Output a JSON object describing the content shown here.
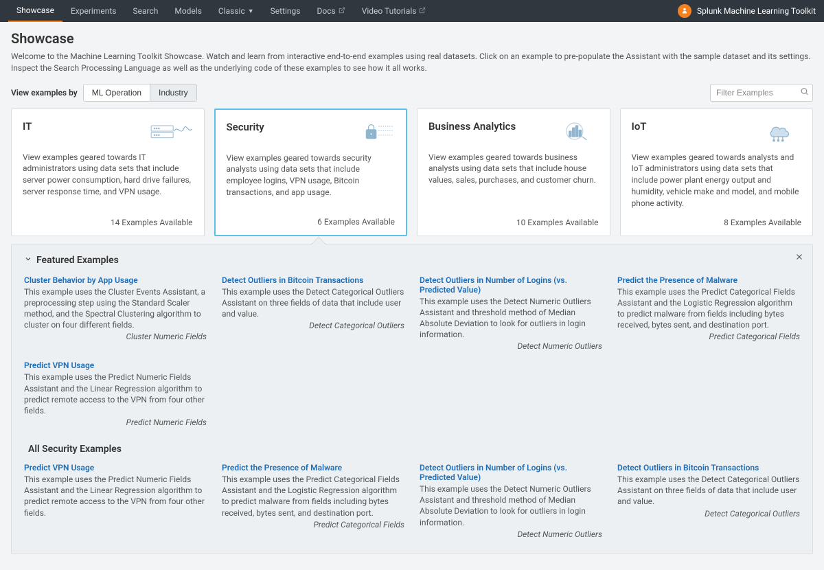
{
  "brand": "Splunk Machine Learning Toolkit",
  "nav": {
    "showcase": "Showcase",
    "experiments": "Experiments",
    "search": "Search",
    "models": "Models",
    "classic": "Classic",
    "settings": "Settings",
    "docs": "Docs",
    "video": "Video Tutorials"
  },
  "page": {
    "title": "Showcase",
    "subtitle": "Welcome to the Machine Learning Toolkit Showcase. Watch and learn from interactive end-to-end examples using real datasets. Click on an example to pre-populate the Assistant with the sample dataset and its settings. Inspect the Search Processing Language as well as the underlying code of these examples to see how it all works."
  },
  "filter": {
    "label": "View examples by",
    "opt1": "ML Operation",
    "opt2": "Industry"
  },
  "search": {
    "placeholder": "Filter Examples"
  },
  "cards": [
    {
      "title": "IT",
      "desc": "View examples geared towards IT administrators using data sets that include server power consumption, hard drive failures, server response time, and VPN usage.",
      "foot": "14 Examples Available"
    },
    {
      "title": "Security",
      "desc": "View examples geared towards security analysts using data sets that include employee logins, VPN usage, Bitcoin transactions, and app usage.",
      "foot": "6 Examples Available"
    },
    {
      "title": "Business Analytics",
      "desc": "View examples geared towards business analysts using data sets that include house values, sales, purchases, and customer churn.",
      "foot": "10 Examples Available"
    },
    {
      "title": "IoT",
      "desc": "View examples geared towards analysts and IoT administrators using data sets that include power plant energy output and humidity, vehicle make and model, and mobile phone activity.",
      "foot": "8 Examples Available"
    }
  ],
  "featured": {
    "head": "Featured Examples",
    "items": [
      {
        "title": "Cluster Behavior by App Usage",
        "desc": "This example uses the Cluster Events Assistant, a preprocessing step using the Standard Scaler method, and the Spectral Clustering algorithm to cluster on four different fields.",
        "tag": "Cluster Numeric Fields"
      },
      {
        "title": "Detect Outliers in Bitcoin Transactions",
        "desc": "This example uses the Detect Categorical Outliers Assistant on three fields of data that include user and value.",
        "tag": "Detect Categorical Outliers"
      },
      {
        "title": "Detect Outliers in Number of Logins (vs. Predicted Value)",
        "desc": "This example uses the Detect Numeric Outliers Assistant and threshold method of Median Absolute Deviation to look for outliers in login information.",
        "tag": "Detect Numeric Outliers"
      },
      {
        "title": "Predict the Presence of Malware",
        "desc": "This example uses the Predict Categorical Fields Assistant and the Logistic Regression algorithm to predict malware from fields including bytes received, bytes sent, and destination port.",
        "tag": "Predict Categorical Fields"
      },
      {
        "title": "Predict VPN Usage",
        "desc": "This example uses the Predict Numeric Fields Assistant and the Linear Regression algorithm to predict remote access to the VPN from four other fields.",
        "tag": "Predict Numeric Fields"
      }
    ]
  },
  "all": {
    "head": "All Security Examples",
    "items": [
      {
        "title": "Predict VPN Usage",
        "desc": "This example uses the Predict Numeric Fields Assistant and the Linear Regression algorithm to predict remote access to the VPN from four other fields.",
        "tag": ""
      },
      {
        "title": "Predict the Presence of Malware",
        "desc": "This example uses the Predict Categorical Fields Assistant and the Logistic Regression algorithm to predict malware from fields including bytes received, bytes sent, and destination port.",
        "tag": "Predict Categorical Fields"
      },
      {
        "title": "Detect Outliers in Number of Logins (vs. Predicted Value)",
        "desc": "This example uses the Detect Numeric Outliers Assistant and threshold method of Median Absolute Deviation to look for outliers in login information.",
        "tag": "Detect Numeric Outliers"
      },
      {
        "title": "Detect Outliers in Bitcoin Transactions",
        "desc": "This example uses the Detect Categorical Outliers Assistant on three fields of data that include user and value.",
        "tag": "Detect Categorical Outliers"
      }
    ]
  }
}
